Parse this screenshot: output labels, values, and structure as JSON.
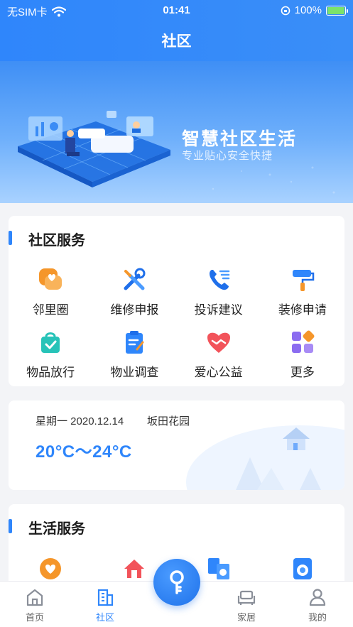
{
  "status": {
    "carrier": "无SIM卡",
    "time": "01:41",
    "battery": "100%",
    "battery_level": 1.0
  },
  "nav": {
    "title": "社区"
  },
  "banner": {
    "title": "智慧社区生活",
    "subtitle": "专业贴心安全快捷"
  },
  "community": {
    "title": "社区服务",
    "items": [
      {
        "label": "邻里圈",
        "icon": "chat-heart-icon",
        "color": "#f5962a"
      },
      {
        "label": "维修申报",
        "icon": "tools-icon",
        "color": "#2f86fb"
      },
      {
        "label": "投诉建议",
        "icon": "phone-icon",
        "color": "#2f86fb"
      },
      {
        "label": "装修申请",
        "icon": "paint-roller-icon",
        "color": "#2f86fb"
      },
      {
        "label": "物品放行",
        "icon": "bag-check-icon",
        "color": "#27c3b8"
      },
      {
        "label": "物业调查",
        "icon": "clipboard-icon",
        "color": "#2f86fb"
      },
      {
        "label": "爱心公益",
        "icon": "handshake-heart-icon",
        "color": "#f2535a"
      },
      {
        "label": "更多",
        "icon": "apps-icon",
        "color": "#8b6cf0"
      }
    ]
  },
  "weather": {
    "date": "星期一 2020.12.14",
    "place": "坂田花园",
    "temperature": "20°C～24°C"
  },
  "life": {
    "title": "生活服务",
    "icons": [
      "heart-badge-icon",
      "house-icon",
      "washer-pair-icon",
      "washing-machine-icon"
    ]
  },
  "tabbar": {
    "tabs": [
      {
        "label": "首页",
        "icon": "home-icon"
      },
      {
        "label": "社区",
        "icon": "building-icon"
      },
      {
        "label": "家居",
        "icon": "sofa-icon"
      },
      {
        "label": "我的",
        "icon": "user-icon"
      }
    ],
    "center_icon": "key-icon",
    "active": "社区",
    "accent": "#2f86fb"
  }
}
